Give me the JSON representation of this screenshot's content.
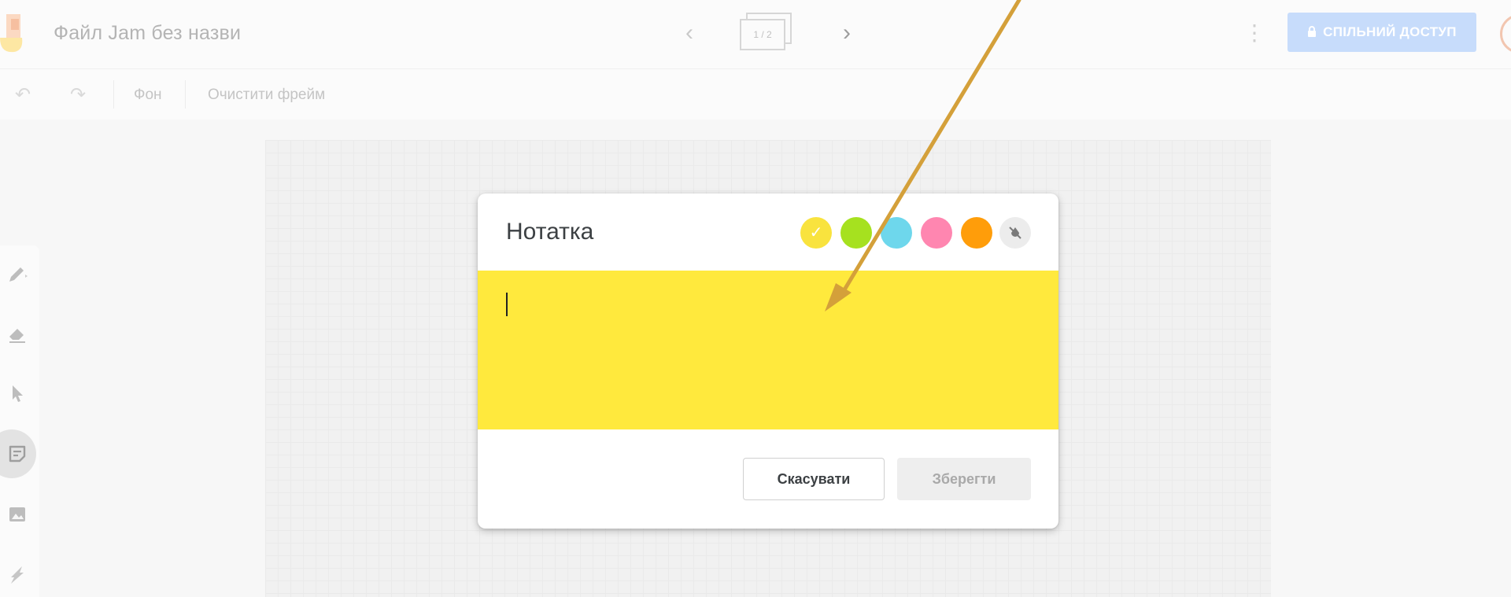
{
  "header": {
    "file_title": "Файл Jam без назви",
    "frame_indicator": "1 / 2",
    "share_label": "СПІЛЬНИЙ ДОСТУП"
  },
  "toolbar": {
    "background_label": "Фон",
    "clear_frame_label": "Очистити фрейм"
  },
  "sidebar": {
    "tools": [
      "pen-icon",
      "eraser-icon",
      "select-icon",
      "sticky-note-icon",
      "image-icon",
      "laser-icon"
    ],
    "active_tool": "sticky-note-icon"
  },
  "note_dialog": {
    "title": "Нотатка",
    "text_value": "",
    "colors": [
      "#f9e33e",
      "#a6e11f",
      "#6ed7ec",
      "#ff86b0",
      "#ff9d0a"
    ],
    "selected_color": "#f9e33e",
    "note_background": "#ffe93d",
    "cancel_label": "Скасувати",
    "save_label": "Зберегти"
  },
  "annotation": {
    "arrow_color": "#d4a03a"
  }
}
